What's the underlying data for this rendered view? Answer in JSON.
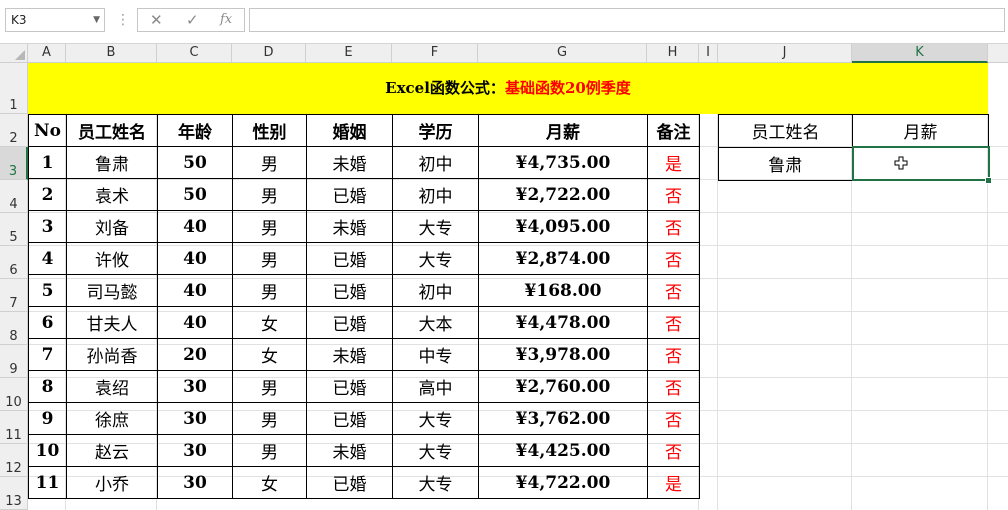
{
  "formula_bar": {
    "name_box": "K3",
    "cancel_icon": "✕",
    "enter_icon": "✓",
    "fx_icon": "fx",
    "formula": ""
  },
  "columns": [
    "A",
    "B",
    "C",
    "D",
    "E",
    "F",
    "G",
    "H",
    "I",
    "J",
    "K"
  ],
  "selected_column": "K",
  "rows": [
    "1",
    "2",
    "3",
    "4",
    "5",
    "6",
    "7",
    "8",
    "9",
    "10",
    "11",
    "12",
    "13"
  ],
  "selected_row": "3",
  "title": {
    "part1": "Excel函数公式：",
    "part2": "基础函数20例季度"
  },
  "table": {
    "headers": [
      "No",
      "员工姓名",
      "年龄",
      "性别",
      "婚姻",
      "学历",
      "月薪",
      "备注"
    ],
    "rows": [
      [
        "1",
        "鲁肃",
        "50",
        "男",
        "未婚",
        "初中",
        "¥4,735.00",
        "是"
      ],
      [
        "2",
        "袁术",
        "50",
        "男",
        "已婚",
        "初中",
        "¥2,722.00",
        "否"
      ],
      [
        "3",
        "刘备",
        "40",
        "男",
        "未婚",
        "大专",
        "¥4,095.00",
        "否"
      ],
      [
        "4",
        "许攸",
        "40",
        "男",
        "已婚",
        "大专",
        "¥2,874.00",
        "否"
      ],
      [
        "5",
        "司马懿",
        "40",
        "男",
        "已婚",
        "初中",
        "¥168.00",
        "否"
      ],
      [
        "6",
        "甘夫人",
        "40",
        "女",
        "已婚",
        "大本",
        "¥4,478.00",
        "否"
      ],
      [
        "7",
        "孙尚香",
        "20",
        "女",
        "未婚",
        "中专",
        "¥3,978.00",
        "否"
      ],
      [
        "8",
        "袁绍",
        "30",
        "男",
        "已婚",
        "高中",
        "¥2,760.00",
        "否"
      ],
      [
        "9",
        "徐庶",
        "30",
        "男",
        "已婚",
        "大专",
        "¥3,762.00",
        "否"
      ],
      [
        "10",
        "赵云",
        "30",
        "男",
        "未婚",
        "大专",
        "¥4,425.00",
        "否"
      ],
      [
        "11",
        "小乔",
        "30",
        "女",
        "已婚",
        "大专",
        "¥4,722.00",
        "是"
      ]
    ]
  },
  "lookup": {
    "headers": [
      "员工姓名",
      "月薪"
    ],
    "name": "鲁肃",
    "salary": ""
  },
  "colors": {
    "title_fill": "#ffff00",
    "accent_red": "#ff0000",
    "selection_green": "#217346"
  }
}
